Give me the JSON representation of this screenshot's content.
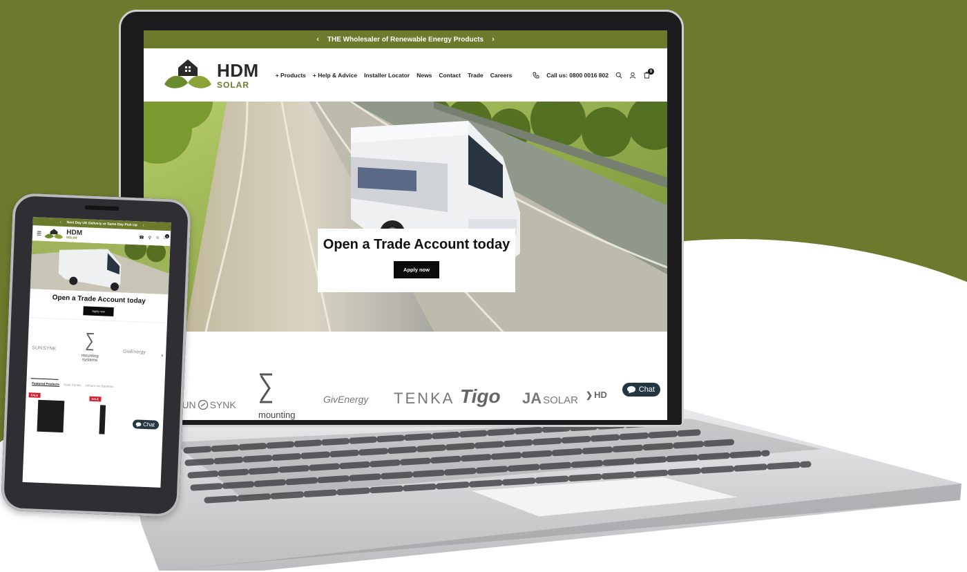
{
  "colors": {
    "brand_green": "#6b7a2b",
    "background_green": "#6d7a2e",
    "button_black": "#0b0b0b",
    "chat_bubble": "#243642",
    "sale_red": "#d2202f"
  },
  "desktop": {
    "announcement": "THE Wholesaler of Renewable Energy Products",
    "logo": {
      "name": "HDM",
      "sub": "SOLAR"
    },
    "nav": [
      "Products",
      "Help & Advice",
      "Installer Locator",
      "News",
      "Contact",
      "Trade",
      "Careers"
    ],
    "phone": "Call us: 0800 0016 802",
    "cart_count": "0",
    "hero": {
      "title": "Open a Trade Account today",
      "button": "Apply now"
    },
    "brands": [
      "SUN",
      "SYNK",
      "mounting",
      "GivEnergy",
      "TENKA",
      "Tigo",
      "JA",
      "SOLAR",
      "HD"
    ],
    "chat_label": "Chat"
  },
  "mobile": {
    "announcement": "Next Day UK Delivery or Same Day Pick Up",
    "logo": {
      "name": "HDM",
      "sub": "SOLAR"
    },
    "cart_count": "0",
    "hero": {
      "title": "Open a Trade Account today",
      "button": "Apply now"
    },
    "brands": [
      "SUN",
      "SYNK",
      "mounting",
      "systems",
      "GivEnergy"
    ],
    "tabs": [
      "Featured Products",
      "Solar Panels",
      "Lithium Ion Batteries"
    ],
    "sale_badge": "SALE",
    "chat_label": "Chat"
  }
}
